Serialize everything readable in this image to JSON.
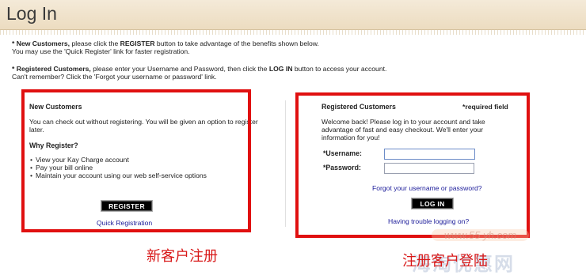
{
  "header": {
    "title": "Log In"
  },
  "intro": {
    "line1_prefix": "* New Customers,",
    "line1_mid": " please click the ",
    "line1_bold": "REGISTER",
    "line1_suffix": " button to take advantage of the benefits shown below.",
    "line2": "You may use the 'Quick Register' link for faster registration.",
    "line3_prefix": "* Registered Customers,",
    "line3_mid": " please enter your Username and Password, then click the ",
    "line3_bold": "LOG IN",
    "line3_suffix": " button to access your account.",
    "line4": "Can't remember? Click the 'Forgot your username or password' link."
  },
  "new_customers": {
    "title": "New Customers",
    "body": "You can check out without registering. You will be given an option to register later.",
    "why_title": "Why Register?",
    "bullets": [
      "View your Kay Charge account",
      "Pay your bill online",
      "Maintain your account using our web self-service options"
    ],
    "register_button": "REGISTER",
    "quick_link": "Quick Registration"
  },
  "registered": {
    "title": "Registered Customers",
    "required_note": "*required field",
    "body": "Welcome back! Please log in to your account and take advantage of fast and easy checkout. We'll enter your information for you!",
    "username_label": "*Username:",
    "username_value": "",
    "password_label": "*Password:",
    "password_value": "",
    "forgot_link": "Forgot your username or password?",
    "login_button": "LOG IN",
    "trouble_link": "Having trouble logging on?"
  },
  "annotations": {
    "left": "新客户注册",
    "right": "注册客户登陆"
  },
  "watermark": {
    "url": "www.55 yh.com",
    "logo": "海淘优惠网"
  },
  "colors": {
    "annotation_red": "#e01010",
    "link_blue": "#1a1a99",
    "header_bg": "#f0e3cc"
  }
}
